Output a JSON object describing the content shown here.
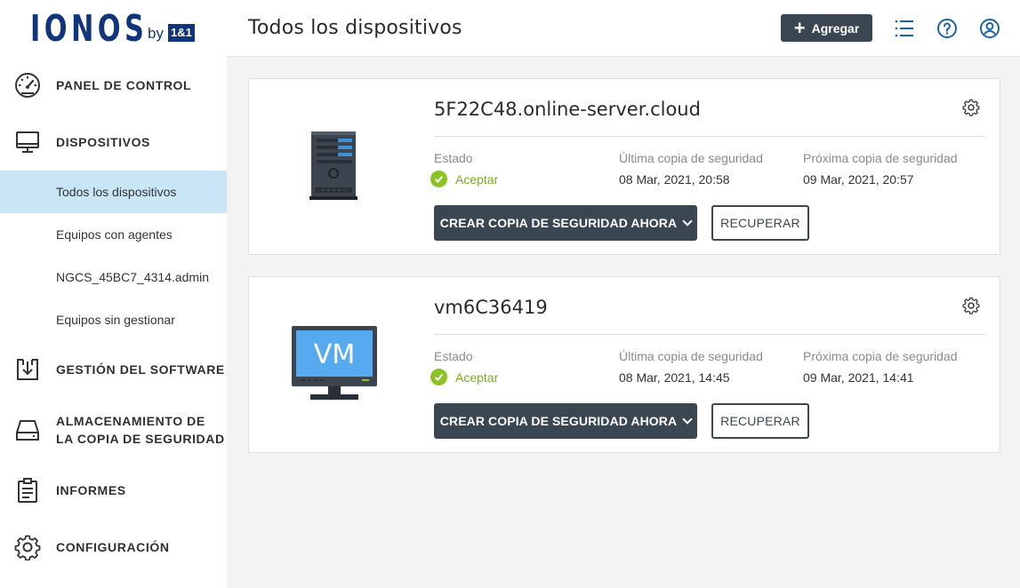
{
  "brand": {
    "logo_word": "IONOS",
    "logo_by": "by",
    "logo_box": "1&1"
  },
  "sidebar": {
    "main_items": [
      {
        "label": "PANEL DE CONTROL",
        "icon": "dashboard-gauge-icon"
      },
      {
        "label": "DISPOSITIVOS",
        "icon": "monitor-icon"
      },
      {
        "label": "GESTIÓN DEL SOFTWARE",
        "icon": "software-download-icon"
      },
      {
        "label_line1": "ALMACENAMIENTO DE",
        "label_line2": "LA COPIA DE SEGURIDAD",
        "icon": "storage-drive-icon"
      },
      {
        "label": "INFORMES",
        "icon": "clipboard-report-icon"
      },
      {
        "label": "CONFIGURACIÓN",
        "icon": "gear-icon"
      }
    ],
    "sub_items": [
      {
        "label": "Todos los dispositivos",
        "active": true
      },
      {
        "label": "Equipos con agentes",
        "active": false
      },
      {
        "label": "NGCS_45BC7_4314.admin",
        "active": false
      },
      {
        "label": "Equipos sin gestionar",
        "active": false
      }
    ]
  },
  "header": {
    "title": "Todos los dispositivos",
    "add_label": "Agregar",
    "icons": [
      "list-menu-icon",
      "help-icon",
      "user-account-icon"
    ]
  },
  "columns": {
    "status": "Estado",
    "last_backup": "Última copia de seguridad",
    "next_backup": "Próxima copia de seguridad"
  },
  "devices": [
    {
      "name": "5F22C48.online-server.cloud",
      "type_icon": "server-icon",
      "status": "Aceptar",
      "last_backup": "08 Mar, 2021, 20:58",
      "next_backup": "09 Mar, 2021, 20:57",
      "backup_label": "CREAR COPIA DE SEGURIDAD AHORA",
      "recover_label": "RECUPERAR"
    },
    {
      "name": "vm6C36419",
      "type_icon": "vm-monitor-icon",
      "vm_text": "VM",
      "status": "Aceptar",
      "last_backup": "08 Mar, 2021, 14:45",
      "next_backup": "09 Mar, 2021, 14:41",
      "backup_label": "CREAR COPIA DE SEGURIDAD AHORA",
      "recover_label": "RECUPERAR"
    }
  ],
  "colors": {
    "brand": "#11357a",
    "button_dark": "#3b4653",
    "active_nav": "#c8e6f6",
    "status_ok": "#8bc225"
  }
}
